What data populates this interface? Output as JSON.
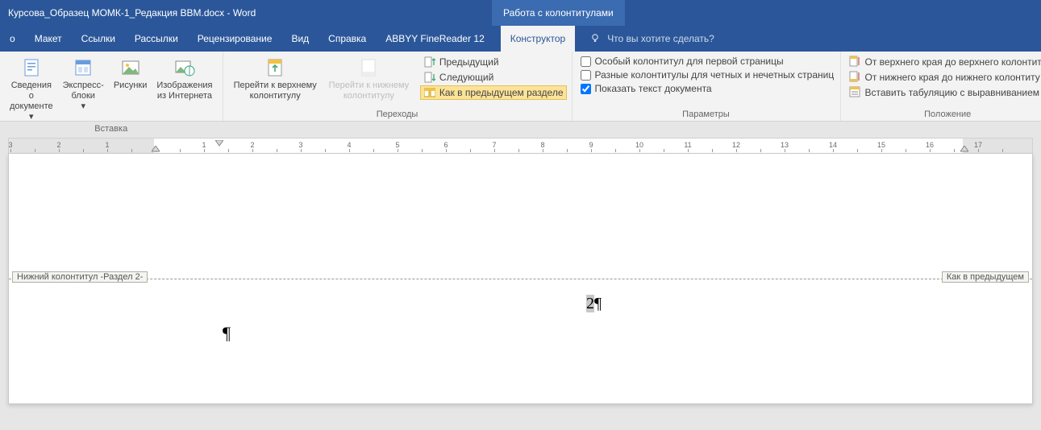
{
  "title": "Курсова_Образец МОМК-1_Редакция ВВМ.docx  -  Word",
  "header_tool_tab": "Работа с колонтитулами",
  "tabs": [
    "о",
    "Макет",
    "Ссылки",
    "Рассылки",
    "Рецензирование",
    "Вид",
    "Справка",
    "ABBYY FineReader 12",
    "Конструктор"
  ],
  "active_tab_index": 8,
  "tellme": "Что вы хотите сделать?",
  "ribbon": {
    "insert": {
      "label": "Вставка",
      "btns": {
        "doc_info": "Сведения о документе",
        "quick_parts": "Экспресс-блоки",
        "pictures": "Рисунки",
        "online_pictures": "Изображения из Интернета"
      }
    },
    "nav": {
      "label": "Переходы",
      "btns": {
        "goto_header": "Перейти к верхнему колонтитулу",
        "goto_footer": "Перейти к нижнему колонтитулу",
        "prev": "Предыдущий",
        "next": "Следующий",
        "link_prev": "Как в предыдущем разделе"
      }
    },
    "options": {
      "label": "Параметры",
      "first_page": "Особый колонтитул для первой страницы",
      "odd_even": "Разные колонтитулы для четных и нечетных страниц",
      "show_doc": "Показать текст документа"
    },
    "position": {
      "label": "Положение",
      "from_top": "От верхнего края до верхнего колонтиту",
      "from_bottom": "От нижнего края до нижнего колонтиту",
      "insert_tab": "Вставить табуляцию с выравниванием"
    }
  },
  "footer_tag_left": "Нижний колонтитул -Раздел 2-",
  "footer_tag_right": "Как в предыдущем",
  "page_number": "2",
  "pilcrow": "¶",
  "ruler_numbers": [
    3,
    2,
    1,
    1,
    2,
    3,
    4,
    5,
    6,
    7,
    8,
    9,
    10,
    11,
    12,
    13,
    14,
    15,
    16,
    17
  ]
}
